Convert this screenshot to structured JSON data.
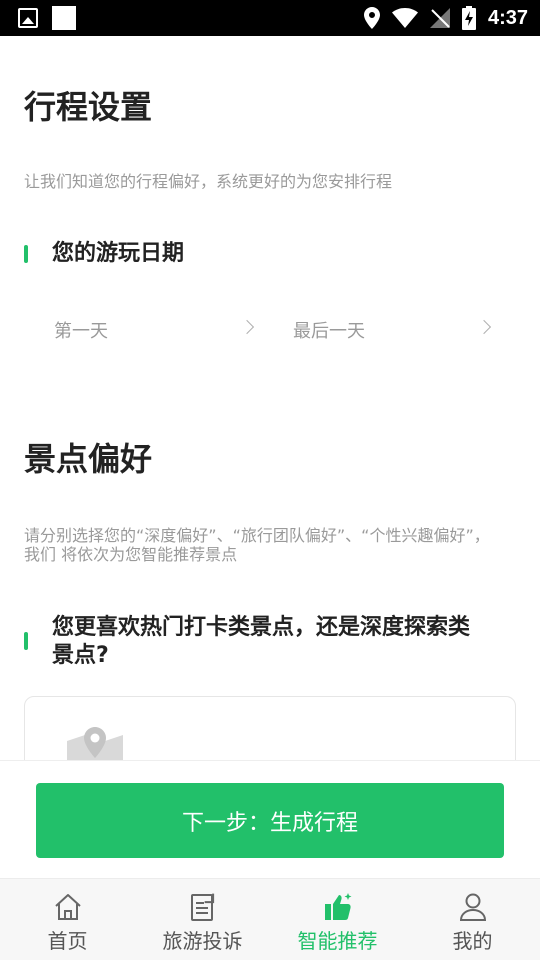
{
  "status_bar": {
    "time": "4:37"
  },
  "trip_settings": {
    "title": "行程设置",
    "subtitle": "让我们知道您的行程偏好，系统更好的为您安排行程",
    "date_section_title": "您的游玩日期",
    "first_day_label": "第一天",
    "last_day_label": "最后一天"
  },
  "scenic_preference": {
    "title": "景点偏好",
    "description_line1": "请分别选择您的“深度偏好”、“旅行团队偏好”、“个性兴趣偏好”，",
    "description_line2": "我们 将依次为您智能推荐景点",
    "question_line1": "您更喜欢热门打卡类景点，还是深度探索类",
    "question_line2": "景点?"
  },
  "next_button": {
    "label": "下一步：生成行程"
  },
  "tabs": [
    {
      "label": "首页",
      "icon": "home-icon",
      "active": false
    },
    {
      "label": "旅游投诉",
      "icon": "complaint-icon",
      "active": false
    },
    {
      "label": "智能推荐",
      "icon": "thumbs-up-icon",
      "active": true
    },
    {
      "label": "我的",
      "icon": "user-icon",
      "active": false
    }
  ],
  "colors": {
    "accent": "#22c06a",
    "text_primary": "#222222",
    "text_secondary": "#9a9a9a",
    "tab_bg": "#f7f7f7"
  }
}
